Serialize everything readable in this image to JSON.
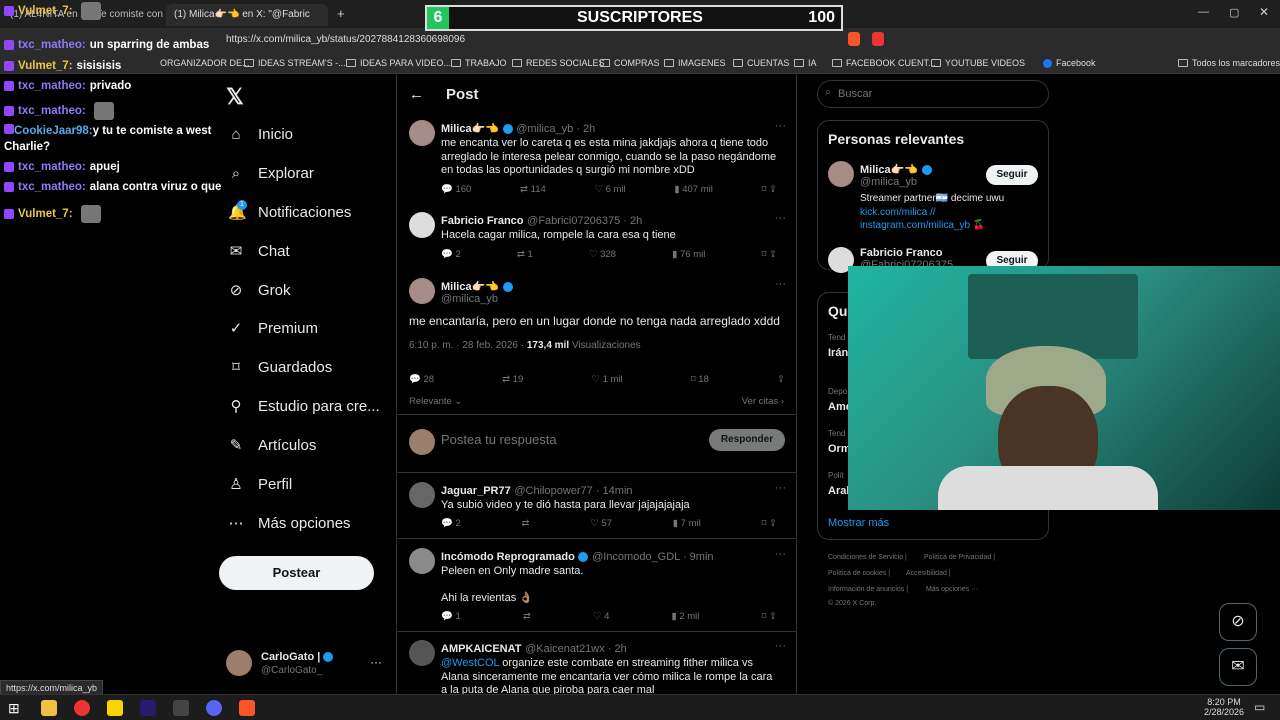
{
  "browser": {
    "tabs": [
      {
        "label": "(1) AL4NITA en X: \"Te comiste con"
      },
      {
        "label": "(1) Milica👉🏻👈 en X: \"@Fabric"
      }
    ],
    "url": "https://x.com/milica_yb/status/2027884128360698096",
    "bookmarks": [
      "ORGANIZADOR DE...",
      "IDEAS STREAM'S -...",
      "IDEAS PARA VIDEO...",
      "TRABAJO",
      "REDES SOCIALES",
      "COMPRAS",
      "IMAGENES",
      "CUENTAS",
      "IA",
      "FACEBOOK CUENT...",
      "YOUTUBE VIDEOS",
      "Facebook",
      "Todos los marcadores"
    ],
    "status_url": "https://x.com/milica_yb"
  },
  "overlay": {
    "subs_num": "6",
    "subs_label": "SUSCRIPTORES",
    "subs_goal": "100"
  },
  "chat": [
    {
      "user": "Vulmet_7:",
      "msg": "",
      "color": "u3"
    },
    {
      "user": "txc_matheo:",
      "msg": "un sparring de ambas",
      "color": "u"
    },
    {
      "user": "Vulmet_7:",
      "msg": "sisisisis",
      "color": "u3"
    },
    {
      "user": "txc_matheo:",
      "msg": "privado",
      "color": "u"
    },
    {
      "user": "txc_matheo:",
      "msg": "",
      "color": "u"
    },
    {
      "user": "CookieJaar98:",
      "msg": "y tu te comiste a west Charlie?",
      "color": "u2"
    },
    {
      "user": "txc_matheo:",
      "msg": "apuej",
      "color": "u"
    },
    {
      "user": "txc_matheo:",
      "msg": "alana contra viruz o que",
      "color": "u"
    },
    {
      "user": "Vulmet_7:",
      "msg": "",
      "color": "u3"
    }
  ],
  "nav": {
    "items": [
      "Inicio",
      "Explorar",
      "Notificaciones",
      "Chat",
      "Grok",
      "Premium",
      "Guardados",
      "Estudio para cre...",
      "Artículos",
      "Perfil",
      "Más opciones"
    ],
    "notif_badge": "1",
    "post_button": "Postear",
    "account_name": "CarloGato |",
    "account_handle": "@CarloGato_"
  },
  "header": {
    "title": "Post"
  },
  "tweets": [
    {
      "name": "Milica👉🏻👈",
      "handle": "@milica_yb · 2h",
      "text": "me encanta ver lo careta q es esta mina jakdjajs ahora q tiene todo arreglado le interesa pelear conmigo, cuando se la paso negándome en todas las oportunidades q surgió mi nombre xDD",
      "replies": "160",
      "reposts": "114",
      "likes": "6 mil",
      "views": "407 mil"
    },
    {
      "name": "Fabricio Franco",
      "handle": "@Fabrici07206375 · 2h",
      "text": "Hacela cagar milica, rompele la cara esa q tiene",
      "replies": "2",
      "reposts": "1",
      "likes": "328",
      "views": "76 mil"
    }
  ],
  "main_tweet": {
    "name": "Milica👉🏻👈",
    "handle": "@milica_yb",
    "text": "me encantaría, pero en un lugar donde no tenga nada arreglado xddd",
    "time": "6:10 p. m. · 28 feb. 2026 ·",
    "views_num": "173,4 mil",
    "views_label": "Visualizaciones",
    "replies": "28",
    "reposts": "19",
    "likes": "1 mil",
    "bookmarks": "18",
    "sort": "Relevante",
    "quotes": "Ver citas"
  },
  "reply_box": {
    "placeholder": "Postea tu respuesta",
    "button": "Responder"
  },
  "replies": [
    {
      "name": "Jaguar_PR77",
      "handle": "@Chilopower77 · 14min",
      "text": "Ya subió video y te dió hasta para llevar jajajajajaja",
      "replies": "2",
      "reposts": "",
      "likes": "57",
      "views": "7 mil"
    },
    {
      "name": "Incómodo Reprogramado",
      "handle": "@Incomodo_GDL · 9min",
      "text": "Peleen en Only madre santa.",
      "text2": "Ahi la revientas 👌🏽",
      "replies": "1",
      "reposts": "",
      "likes": "4",
      "views": "2 mil"
    },
    {
      "name": "AMPKAICENAT",
      "handle": "@Kaicenat21wx · 2h",
      "mention": "@WestCOL",
      "text": "organize este combate en streaming fither milica vs Alana sinceramente me encantaria ver cómo milica le rompe la cara a la puta de Alana que piroba para caer mal"
    }
  ],
  "right": {
    "search_placeholder": "Buscar",
    "relevant_title": "Personas relevantes",
    "people": [
      {
        "name": "Milica👉🏻👈",
        "handle": "@milica_yb",
        "bio1": "Streamer partner🇦🇷 decime uwu",
        "bio2": "kick.com/milica //",
        "bio3": "instagram.com/milica_yb 🍒",
        "button": "Seguir"
      },
      {
        "name": "Fabricio Franco",
        "handle": "@Fabrici07206375",
        "button": "Seguir"
      }
    ],
    "trends_title": "Qu",
    "trends": [
      "Irán",
      "Amé",
      "Orm",
      "Aral"
    ],
    "trend_labels": [
      "Tend",
      "Depo",
      "Tend",
      "Polít"
    ],
    "show_more": "Mostrar más",
    "footer": [
      "Condiciones de Servicio |",
      "Política de Privacidad |",
      "Política de cookies |",
      "Accesibilidad |",
      "Información de anuncios |",
      "Más opciones ···",
      "© 2026 X Corp."
    ]
  },
  "taskbar": {
    "time": "8:20 PM",
    "date": "2/28/2026"
  }
}
